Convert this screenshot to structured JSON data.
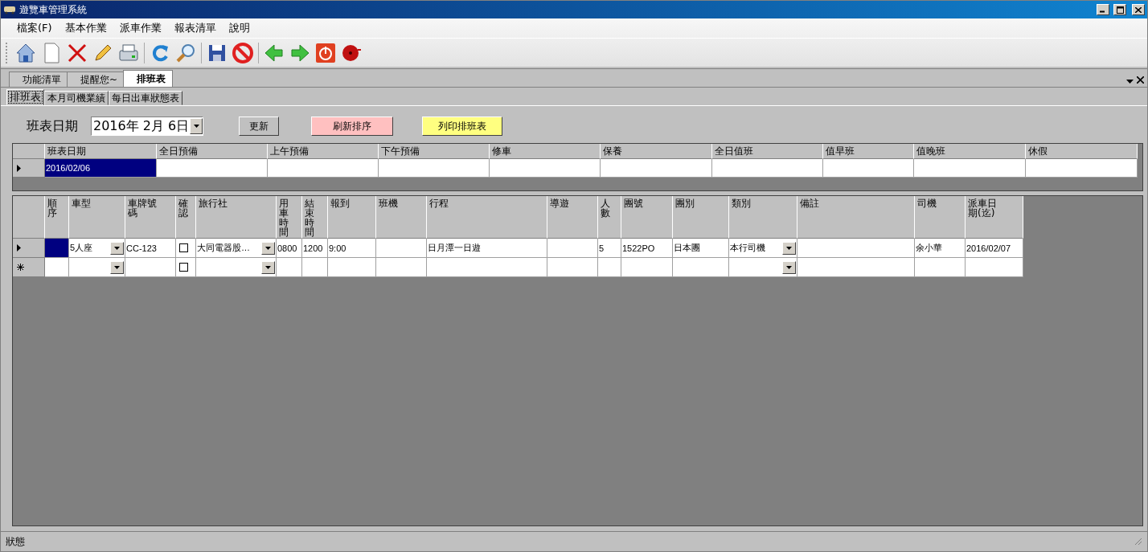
{
  "window": {
    "title": "遊覽車管理系統"
  },
  "menu": [
    {
      "label": "檔案(F)"
    },
    {
      "label": "基本作業"
    },
    {
      "label": "派車作業"
    },
    {
      "label": "報表清單"
    },
    {
      "label": "說明"
    }
  ],
  "doc_tabs": [
    {
      "label": "功能清單",
      "selected": false
    },
    {
      "label": "提醒您~",
      "selected": false
    },
    {
      "label": "排班表",
      "selected": true
    }
  ],
  "sub_tabs": [
    {
      "label": "排班表",
      "selected": true
    },
    {
      "label": "本月司機業績",
      "selected": false
    },
    {
      "label": "每日出車狀態表",
      "selected": false
    }
  ],
  "filter": {
    "label": "班表日期",
    "date": "2016年 2月 6日"
  },
  "buttons": [
    {
      "label": "更新",
      "color": "#c0c0c0"
    },
    {
      "label": "刷新排序",
      "color": "#ffc0c0"
    },
    {
      "label": "列印排班表",
      "color": "#ffff80"
    }
  ],
  "schedule_grid": {
    "columns": [
      "班表日期",
      "全日預備",
      "上午預備",
      "下午預備",
      "修車",
      "保養",
      "全日值班",
      "值早班",
      "值晚班",
      "休假"
    ],
    "rows": [
      {
        "kind": "current",
        "cells": [
          {
            "text": "2016/02/06",
            "selected": true
          },
          {
            "selected": false
          },
          {
            "selected": false
          },
          {
            "selected": false
          },
          {
            "selected": false
          },
          {
            "selected": false
          },
          {
            "selected": false
          },
          {
            "selected": false
          },
          {
            "selected": false
          },
          {
            "selected": false
          }
        ]
      }
    ]
  },
  "dispatch_grid": {
    "columns": [
      {
        "label": "順序",
        "kind": "text"
      },
      {
        "label": "車型",
        "kind": "combo"
      },
      {
        "label": "車牌號碼",
        "kind": "text"
      },
      {
        "label": "確認",
        "kind": "check"
      },
      {
        "label": "旅行社",
        "kind": "combo"
      },
      {
        "label": "用車時間",
        "kind": "text"
      },
      {
        "label": "結束時間",
        "kind": "text"
      },
      {
        "label": "報到",
        "kind": "text"
      },
      {
        "label": "班機",
        "kind": "text"
      },
      {
        "label": "行程",
        "kind": "text"
      },
      {
        "label": "導遊",
        "kind": "text"
      },
      {
        "label": "人數",
        "kind": "text"
      },
      {
        "label": "團號",
        "kind": "text"
      },
      {
        "label": "團別",
        "kind": "text"
      },
      {
        "label": "類別",
        "kind": "combo"
      },
      {
        "label": "備註",
        "kind": "text"
      },
      {
        "label": "司機",
        "kind": "text"
      },
      {
        "label": "派車日期(迄)",
        "kind": "text"
      }
    ],
    "rows": [
      {
        "kind": "current",
        "cells": [
          {
            "selected": true
          },
          {
            "text": "5人座",
            "selected": false
          },
          {
            "text": "CC-123",
            "selected": false
          },
          {
            "checked": false,
            "selected": false
          },
          {
            "text": "大同電器股…",
            "selected": false
          },
          {
            "text": "0800",
            "selected": false
          },
          {
            "text": "1200",
            "selected": false
          },
          {
            "text": "9:00",
            "selected": false
          },
          {
            "selected": false
          },
          {
            "text": "日月潭一日遊",
            "selected": false
          },
          {
            "selected": false
          },
          {
            "text": "5",
            "selected": false
          },
          {
            "text": "1522PO",
            "selected": false
          },
          {
            "text": "日本團",
            "selected": false
          },
          {
            "text": "本行司機",
            "selected": false
          },
          {
            "selected": false
          },
          {
            "text": "余小華",
            "selected": false
          },
          {
            "text": "2016/02/07",
            "selected": false
          }
        ]
      },
      {
        "kind": "new",
        "cells": [
          {
            "selected": false
          },
          {
            "selected": false
          },
          {
            "selected": false
          },
          {
            "checked": false,
            "selected": false
          },
          {
            "selected": false
          },
          {
            "selected": false
          },
          {
            "selected": false
          },
          {
            "selected": false
          },
          {
            "selected": false
          },
          {
            "selected": false
          },
          {
            "selected": false
          },
          {
            "selected": false
          },
          {
            "selected": false
          },
          {
            "selected": false
          },
          {
            "selected": false
          },
          {
            "selected": false
          },
          {
            "selected": false
          },
          {
            "selected": false
          }
        ]
      }
    ]
  },
  "status_bar": {
    "text": "狀態"
  }
}
